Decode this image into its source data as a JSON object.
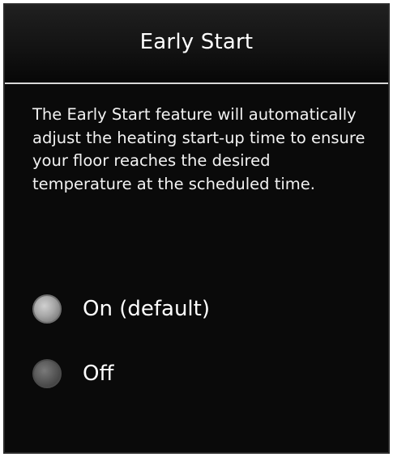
{
  "header": {
    "title": "Early Start"
  },
  "description": "The Early Start feature will automatically adjust the heating start-up time to ensure your floor reaches the desired temperature at the scheduled time.",
  "options": [
    {
      "label": "On (default)",
      "selected": true
    },
    {
      "label": "Off",
      "selected": false
    }
  ],
  "colors": {
    "background": "#0a0a0a",
    "text": "#ffffff",
    "divider": "#d8d8d8",
    "radio_selected": "#a8a8a8",
    "radio_unselected": "#5a5a5a"
  }
}
